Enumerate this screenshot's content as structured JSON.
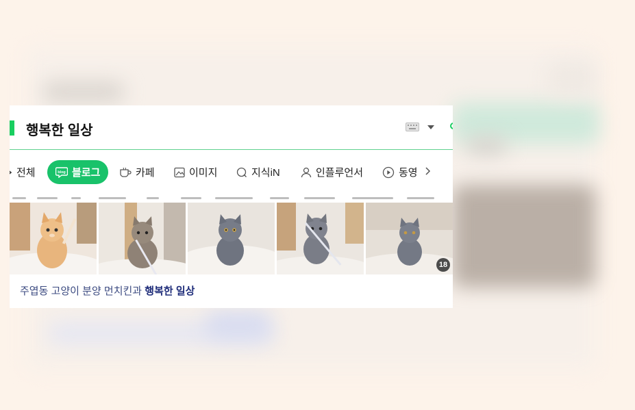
{
  "section": {
    "title": "행복한 일상"
  },
  "tabs": [
    {
      "label": "전체",
      "icon": "all-icon",
      "active": false
    },
    {
      "label": "블로그",
      "icon": "blog-icon",
      "active": true
    },
    {
      "label": "카페",
      "icon": "cafe-icon",
      "active": false
    },
    {
      "label": "이미지",
      "icon": "image-icon",
      "active": false
    },
    {
      "label": "지식iN",
      "icon": "kin-icon",
      "active": false
    },
    {
      "label": "인플루언서",
      "icon": "influencer-icon",
      "active": false
    },
    {
      "label": "동영",
      "icon": "video-icon",
      "active": false
    }
  ],
  "gallery": {
    "more_count": "18"
  },
  "result": {
    "caption_prefix": "주엽동 고양이 분양 먼치킨과 ",
    "caption_highlight": "행복한 일상"
  },
  "colors": {
    "accent_green": "#19ce60",
    "active_tab": "#19c26a",
    "link_blue": "#3b4a80"
  }
}
